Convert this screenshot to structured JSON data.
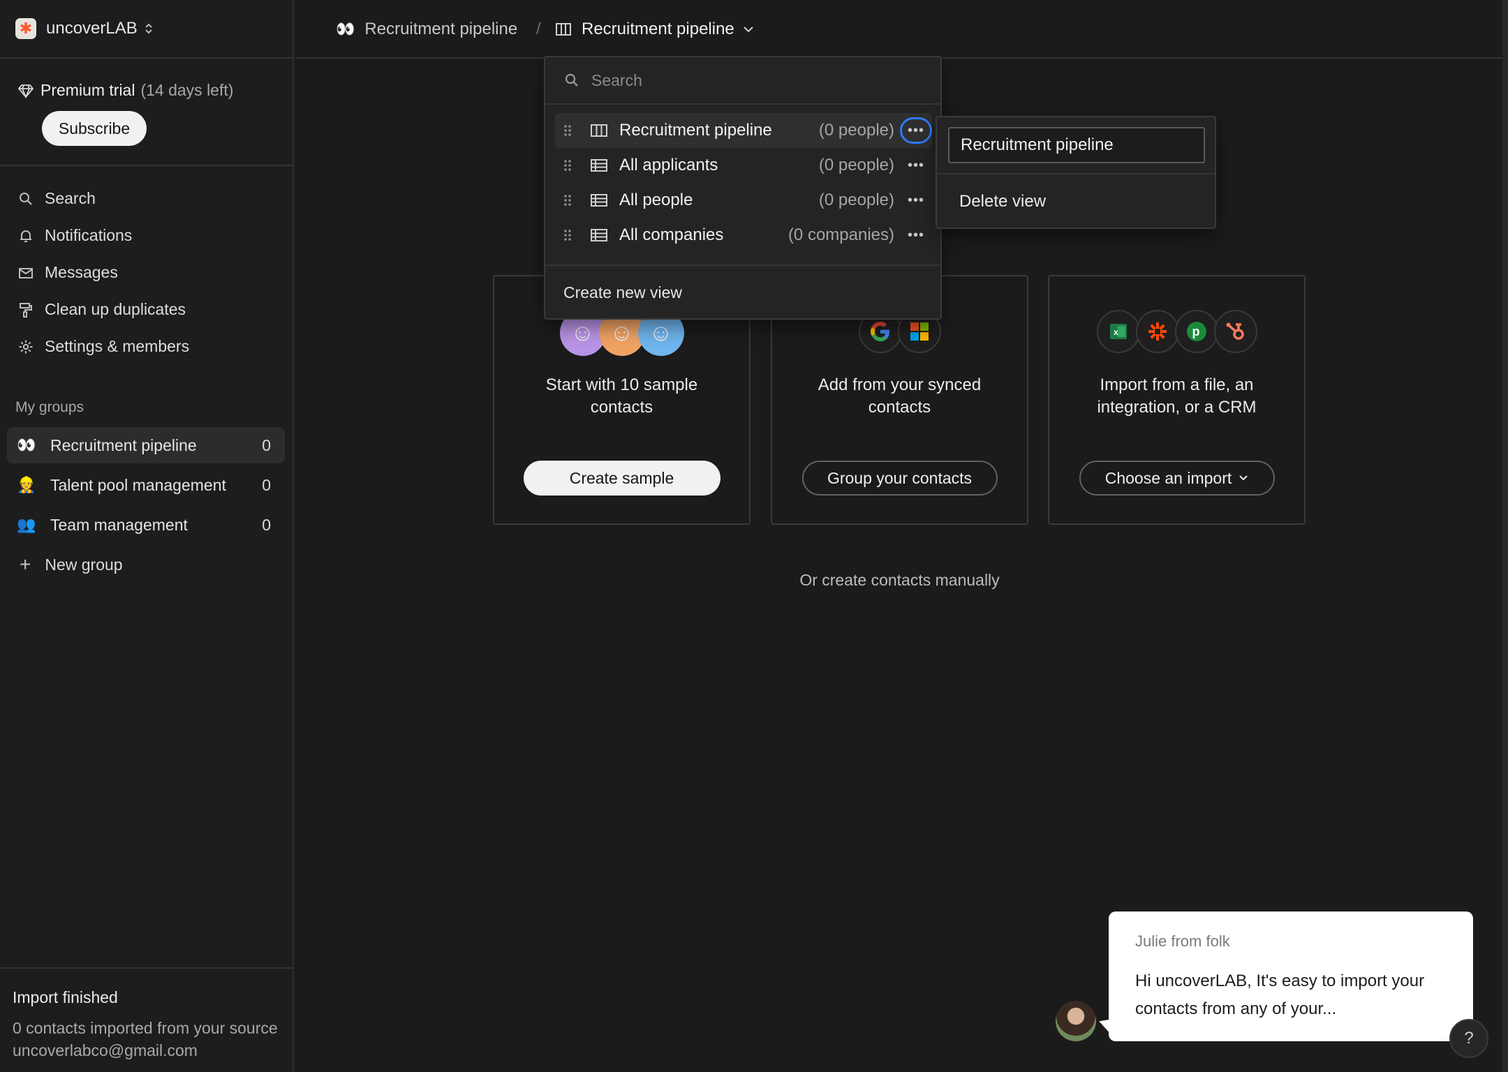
{
  "workspace": {
    "name": "uncoverLAB",
    "logo_glyph": "✱",
    "logo_color": "#ff5a2c"
  },
  "trial": {
    "label": "Premium trial",
    "remaining": "(14 days left)",
    "subscribe_label": "Subscribe"
  },
  "nav": [
    {
      "label": "Search",
      "icon": "search-icon"
    },
    {
      "label": "Notifications",
      "icon": "bell-icon"
    },
    {
      "label": "Messages",
      "icon": "mail-icon"
    },
    {
      "label": "Clean up duplicates",
      "icon": "paint-roller-icon"
    },
    {
      "label": "Settings & members",
      "icon": "gear-icon"
    }
  ],
  "groups": {
    "heading": "My groups",
    "items": [
      {
        "emoji": "👀",
        "label": "Recruitment pipeline",
        "count": "0"
      },
      {
        "emoji": "👷",
        "label": "Talent pool management",
        "count": "0"
      },
      {
        "emoji": "👥",
        "label": "Team management",
        "count": "0"
      }
    ],
    "new_label": "New group"
  },
  "import_status": {
    "title": "Import finished",
    "detail": "0 contacts imported from your source uncoverlabco@gmail.com"
  },
  "topbar": {
    "group_emoji": "👀",
    "group_label": "Recruitment pipeline",
    "separator": "/",
    "view_label": "Recruitment pipeline"
  },
  "views_dropdown": {
    "search_placeholder": "Search",
    "views": [
      {
        "name": "Recruitment pipeline",
        "count": "(0 people)",
        "icon": "board-icon"
      },
      {
        "name": "All applicants",
        "count": "(0 people)",
        "icon": "table-icon"
      },
      {
        "name": "All people",
        "count": "(0 people)",
        "icon": "table-icon"
      },
      {
        "name": "All companies",
        "count": "(0 companies)",
        "icon": "table-icon"
      }
    ],
    "create_label": "Create new view"
  },
  "view_options": {
    "rename_value": "Recruitment pipeline",
    "delete_label": "Delete view"
  },
  "onboarding": {
    "cards": [
      {
        "text_line1": "Start with 10 sample",
        "text_line2": "contacts",
        "button": "Create sample"
      },
      {
        "text_line1": "Add from your synced",
        "text_line2": "contacts",
        "button": "Group your contacts"
      },
      {
        "text_line1": "Import from a file, an",
        "text_line2": "integration, or a CRM",
        "button": "Choose an import"
      }
    ],
    "manual_link": "Or create contacts manually"
  },
  "chat": {
    "from": "Julie from folk",
    "message": "Hi uncoverLAB, It's easy to import your contacts from any of your..."
  },
  "colors": {
    "focus_ring": "#2f7bff",
    "background": "#1b1b1b",
    "surface": "#242424"
  }
}
